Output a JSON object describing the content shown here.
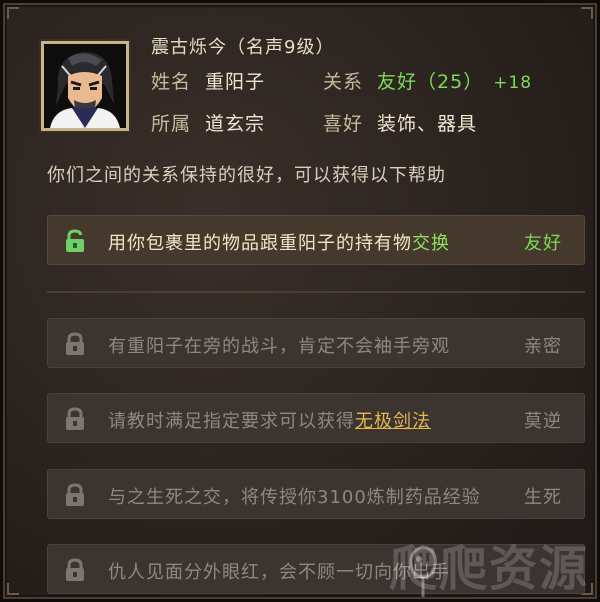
{
  "npc": {
    "title": "震古烁今（名声9级）",
    "name_label": "姓名",
    "name": "重阳子",
    "relation_label": "关系",
    "relation": "友好（25）",
    "relation_bonus": "+18",
    "faction_label": "所属",
    "faction": "道玄宗",
    "likes_label": "喜好",
    "likes": "装饰、器具"
  },
  "description": "你们之间的关系保持的很好，可以获得以下帮助",
  "perks": [
    {
      "text_pre": "用你包裹里的物品跟重阳子的持有物",
      "text_hl": "交换",
      "text_post": "",
      "tier": "友好",
      "unlocked": true,
      "lock_icon": "unlocked-padlock-icon"
    },
    {
      "text_pre": "有重阳子在旁的战斗，肯定不会袖手旁观",
      "text_hl": "",
      "text_post": "",
      "tier": "亲密",
      "unlocked": false,
      "lock_icon": "padlock-icon"
    },
    {
      "text_pre": "请教时满足指定要求可以获得",
      "text_hl": "无极剑法",
      "text_post": "",
      "tier": "莫逆",
      "unlocked": false,
      "lock_icon": "padlock-icon"
    },
    {
      "text_pre": "与之生死之交，将传授你3100炼制药品经验",
      "text_hl": "",
      "text_post": "",
      "tier": "生死",
      "unlocked": false,
      "lock_icon": "padlock-icon"
    },
    {
      "text_pre": "仇人见面分外眼红，会不顾一切向你出手",
      "text_hl": "",
      "text_post": "",
      "tier": "",
      "unlocked": false,
      "lock_icon": "padlock-icon"
    }
  ],
  "watermark": "爬爬资源",
  "colors": {
    "friendly_green": "#7ed957",
    "highlight_gold": "#e5b84c",
    "panel_bg": "#2a221e"
  }
}
